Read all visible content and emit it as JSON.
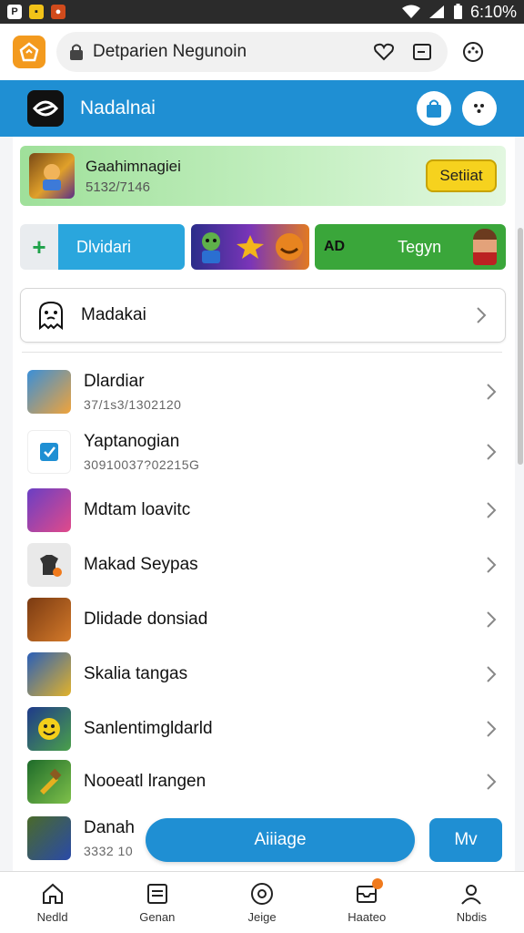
{
  "status_bar": {
    "time": "6:10%",
    "left_icons": [
      "p-icon",
      "yellow-app-icon",
      "game-app-icon"
    ],
    "right_icons": [
      "wifi-icon",
      "signal-icon",
      "battery-icon"
    ]
  },
  "browser": {
    "url_text": "Detparien Negunoin",
    "icons": [
      "home-logo-icon",
      "lock-icon",
      "heart-icon",
      "tabs-icon",
      "menu-icon"
    ]
  },
  "app_header": {
    "title": "Nadalnai",
    "buttons": [
      "bag-icon",
      "more-icon"
    ]
  },
  "banner": {
    "title": "Gaahimnagiei",
    "subtitle": "5132/7146",
    "button_label": "Setiiat"
  },
  "promos": {
    "blue_label": "Dlvidari",
    "green_icon_text": "AD",
    "green_label": "Tegyn"
  },
  "search_card": {
    "label": "Madakai"
  },
  "list_items": [
    {
      "title": "Dlardiar",
      "subtitle": "37/1s3/1302120"
    },
    {
      "title": "Yaptanogian",
      "subtitle": "30910037?02215G"
    },
    {
      "title": "Mdtam loavitc",
      "subtitle": ""
    },
    {
      "title": "Makad Seypas",
      "subtitle": ""
    },
    {
      "title": "Dlidade donsiad",
      "subtitle": ""
    },
    {
      "title": "Skalia tangas",
      "subtitle": ""
    },
    {
      "title": "Sanlentimgldarld",
      "subtitle": ""
    },
    {
      "title": "Nooeatl lrangen",
      "subtitle": ""
    },
    {
      "title": "Danah",
      "subtitle": "3332 10"
    }
  ],
  "actions": {
    "primary_label": "Aiiiage",
    "secondary_label": "Mv"
  },
  "bottom_nav": [
    {
      "label": "Nedld",
      "icon": "home-icon"
    },
    {
      "label": "Genan",
      "icon": "card-icon"
    },
    {
      "label": "Jeige",
      "icon": "circle-icon"
    },
    {
      "label": "Haateo",
      "icon": "inbox-icon"
    },
    {
      "label": "Nbdis",
      "icon": "profile-icon"
    }
  ],
  "colors": {
    "accent_blue": "#1f8fd3",
    "banner_green": "#9fe09a",
    "button_yellow": "#f6d21e",
    "promo_green": "#3aa63a",
    "status_bar": "#2b2b2b"
  }
}
